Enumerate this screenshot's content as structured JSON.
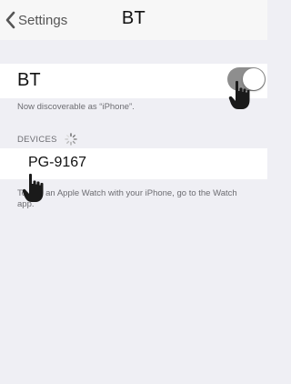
{
  "nav": {
    "back_label": "Settings",
    "title": "BT"
  },
  "bluetooth": {
    "label": "BT",
    "toggle_on": true,
    "discoverable_text": "Now discoverable as “iPhone”."
  },
  "devices": {
    "header": "DEVICES",
    "items": [
      {
        "name": "PG-9167"
      }
    ],
    "watch_note": "To pair an Apple Watch with your iPhone, go to the Watch app."
  },
  "icons": {
    "back": "chevron-left-icon",
    "spinner": "loading-spinner-icon",
    "pointer": "hand-pointer-icon"
  },
  "colors": {
    "background": "#efeff4",
    "toggle": "#8e8e8e",
    "secondary_text": "#6d6d72"
  }
}
